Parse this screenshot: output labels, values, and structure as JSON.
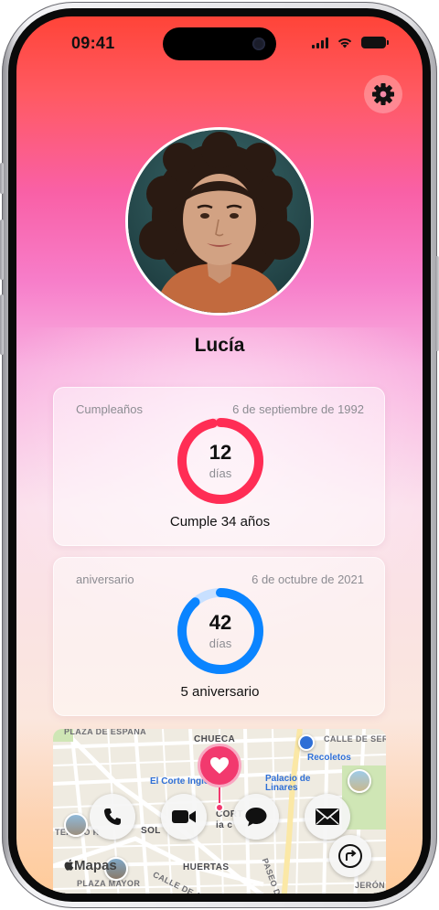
{
  "status_bar": {
    "time": "09:41"
  },
  "contact": {
    "name": "Lucía"
  },
  "birthday_card": {
    "label": "Cumpleaños",
    "date": "6 de septiembre de 1992",
    "count": "12",
    "unit": "días",
    "footer": "Cumple 34 años",
    "progress": 0.967,
    "color": "#ff2d55"
  },
  "anniversary_card": {
    "label": "aniversario",
    "date": "6 de octubre de 2021",
    "count": "42",
    "unit": "días",
    "footer": "5 aniversario",
    "progress": 0.885,
    "color": "#0a84ff"
  },
  "map": {
    "brand": "Mapas",
    "labels": {
      "plaza": "PLAZA DE ESPAÑA",
      "chueca": "CHUECA",
      "calle_serrano": "CALLE DE SERRANO",
      "recoletos": "Recoletos",
      "corte_ingles": "El Corte Inglés",
      "palacio": "Palacio de Linares",
      "teatro": "TEATRO R",
      "sol": "SOL",
      "cortes": "CORT",
      "cortes_sub": "ia c",
      "paseo_prado": "PASEO DEL PRADO",
      "huertas": "HUERTAS",
      "plaza_mayor": "PLAZA MAYOR",
      "calle_atocha": "CALLE DE ATOCHA",
      "jeron": "JERÓN"
    }
  },
  "actions": [
    {
      "name": "call-button",
      "icon": "phone-icon"
    },
    {
      "name": "video-call-button",
      "icon": "video-camera-icon"
    },
    {
      "name": "message-button",
      "icon": "message-bubble-icon"
    },
    {
      "name": "mail-button",
      "icon": "envelope-icon"
    },
    {
      "name": "directions-button",
      "icon": "directions-arrow-icon"
    }
  ],
  "colors": {
    "accent": "#f2396e",
    "birthday_ring": "#ff2d55",
    "anniversary_ring": "#0a84ff"
  }
}
